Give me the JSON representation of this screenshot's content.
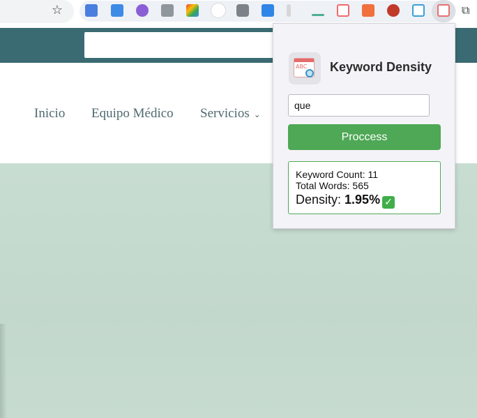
{
  "toolbar": {
    "bookmark_icon": "star-icon",
    "extensions": [
      {
        "name": "google-translate-icon",
        "color": "#4a7fe0"
      },
      {
        "name": "download-icon",
        "color": "#3d8be6"
      },
      {
        "name": "gear-icon",
        "color": "#8a5fd6"
      },
      {
        "name": "code-icon",
        "color": "#8f969c"
      },
      {
        "name": "google-maps-icon",
        "color": "#3fa65a"
      },
      {
        "name": "dropdown-icon",
        "color": "#bdbdbd"
      },
      {
        "name": "camera-icon",
        "color": "#7d8288"
      },
      {
        "name": "screen-reader-icon",
        "color": "#2f86e6"
      },
      {
        "name": "ruler-icon",
        "color": "#d7d7d7"
      },
      {
        "name": "line-icon",
        "color": "#4caf8f"
      },
      {
        "name": "screenshot-icon",
        "color": "#f06a6a"
      },
      {
        "name": "grammarly-icon",
        "color": "#f0703e"
      },
      {
        "name": "shield-icon",
        "color": "#c0392b"
      },
      {
        "name": "window-capture-icon",
        "color": "#3ba0d8"
      },
      {
        "name": "keyword-density-icon",
        "color": "#e76f6f"
      }
    ],
    "puzzle_icon": "puzzle-icon"
  },
  "nav": {
    "items": [
      {
        "label": "Inicio"
      },
      {
        "label": "Equipo Médico"
      },
      {
        "label": "Servicios",
        "chevron": "⌄"
      }
    ]
  },
  "popup": {
    "title": "Keyword Density",
    "keyword_value": "que",
    "process_label": "Proccess",
    "results": {
      "keyword_count": "Keyword Count: 11",
      "total_words": "Total Words: 565",
      "density_label": "Density: ",
      "density_value": "1.95%",
      "status_icon": "check-icon"
    },
    "accent": "#4ea855"
  },
  "colors": {
    "header_bar": "#3a6a72",
    "hero": "#c5dbd0"
  }
}
